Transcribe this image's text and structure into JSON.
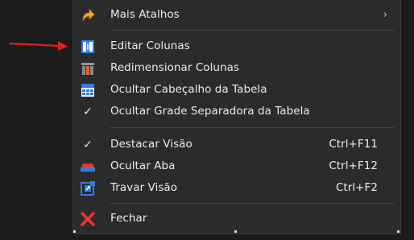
{
  "menu": {
    "items": [
      {
        "id": "mais-atalhos",
        "label": "Mais Atalhos",
        "submenu_glyph": "›",
        "icon": "shortcut-arrow-icon"
      },
      {
        "id": "editar-colunas",
        "label": "Editar Colunas",
        "icon": "edit-columns-icon"
      },
      {
        "id": "redimensionar-colunas",
        "label": "Redimensionar Colunas",
        "icon": "resize-columns-icon"
      },
      {
        "id": "ocultar-cabecalho",
        "label": "Ocultar Cabeçalho da Tabela",
        "icon": "table-header-icon"
      },
      {
        "id": "ocultar-grade",
        "label": "Ocultar Grade Separadora da Tabela",
        "icon": "check-icon",
        "glyph": "✓"
      },
      {
        "id": "destacar-visao",
        "label": "Destacar Visão",
        "shortcut": "Ctrl+F11",
        "icon": "check-icon",
        "glyph": "✓"
      },
      {
        "id": "ocultar-aba",
        "label": "Ocultar Aba",
        "shortcut": "Ctrl+F12",
        "icon": "hide-tab-icon"
      },
      {
        "id": "travar-visao",
        "label": "Travar Visão",
        "shortcut": "Ctrl+F2",
        "icon": "lock-view-icon"
      },
      {
        "id": "fechar",
        "label": "Fechar",
        "icon": "close-icon"
      }
    ]
  },
  "colors": {
    "background": "#1b1b1b",
    "menu_bg": "#2b2b2b",
    "text": "#ececec",
    "separator": "#474747",
    "annotation_arrow": "#e02020",
    "icon_blue": "#2f7fe0",
    "icon_orange": "#f5a623",
    "icon_red": "#e8382e"
  }
}
